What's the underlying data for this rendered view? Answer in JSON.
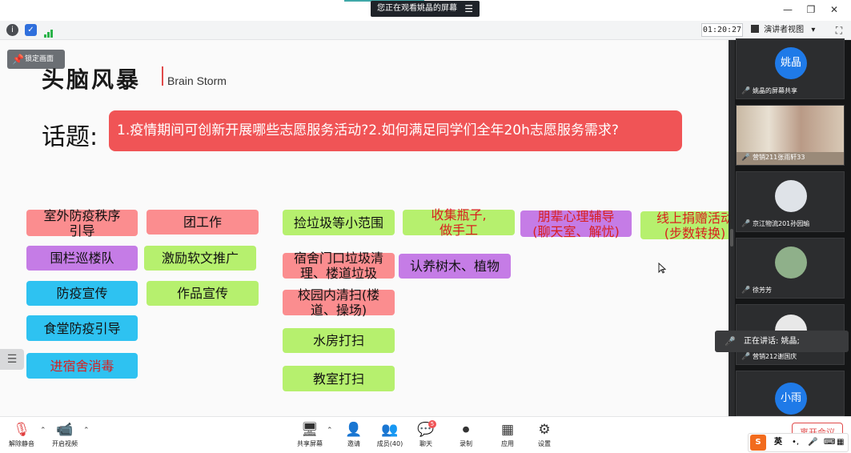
{
  "titlebar": {
    "viewing_text": "您正在观看姚晶的屏幕",
    "menu_glyph": "☰",
    "minimize": "—",
    "restore": "❐",
    "close": "✕"
  },
  "toolbar": {
    "timer": "01:20:27",
    "view_mode": "演讲者视图",
    "view_mode_caret": "▾",
    "fullscreen_glyph": "⛶"
  },
  "slide": {
    "lock_label": "锁定画面",
    "title": "头脑风暴",
    "subtitle": "Brain Storm",
    "topic_label": "话题:",
    "topic_text": "1.疫情期间可创新开展哪些志愿服务活动?2.如何满足同学们全年20h志愿服务需求?",
    "ideas": {
      "outdoor_order": "室外防疫秩序\n引导",
      "fence_patrol": "围栏巡楼队",
      "publicity": "防疫宣传",
      "canteen": "食堂防疫引导",
      "disinfect": "进宿舍消毒",
      "group_work": "团工作",
      "softtext": "激励软文推广",
      "works_promo": "作品宣传",
      "pick_trash": "捡垃圾等小范围",
      "dorm_trash": "宿舍门口垃圾清\n理、楼道垃圾",
      "campus_clean": "校园内清扫(楼\n道、操场)",
      "water_room": "水房打扫",
      "classroom": "教室打扫",
      "bottles": "收集瓶子,\n做手工",
      "adopt_tree": "认养树木、植物",
      "peer_counsel": "朋辈心理辅导\n(聊天室、解忧)",
      "online_donate": "线上捐赠活动\n(步数转换)"
    }
  },
  "side_panel": {
    "tiles": [
      {
        "avatar_text": "姚晶",
        "name": "姚晶的屏幕共享"
      },
      {
        "avatar_text": "",
        "name": "营销211张雨轩33"
      },
      {
        "avatar_text": "",
        "name": "京江物流201孙园瑜"
      },
      {
        "avatar_text": "",
        "name": "徐芳芳"
      },
      {
        "avatar_text": "",
        "name": "营销212谢国庆"
      },
      {
        "avatar_text": "小雨",
        "name": ""
      }
    ],
    "speaking": "正在讲话: 姚晶;",
    "colors": {
      "avatar_blue": "#1f7ae8",
      "panel_bg": "#151617"
    }
  },
  "list_toggle": "☰",
  "bottombar": {
    "unmute": "解除静音",
    "start_video": "开启视频",
    "share_screen": "共享屏幕",
    "invite": "邀请",
    "members": "成员(40)",
    "chat": "聊天",
    "chat_badge": "5",
    "record": "录制",
    "apps": "应用",
    "settings": "设置",
    "leave": "离开会议",
    "ime_lang": "英"
  }
}
